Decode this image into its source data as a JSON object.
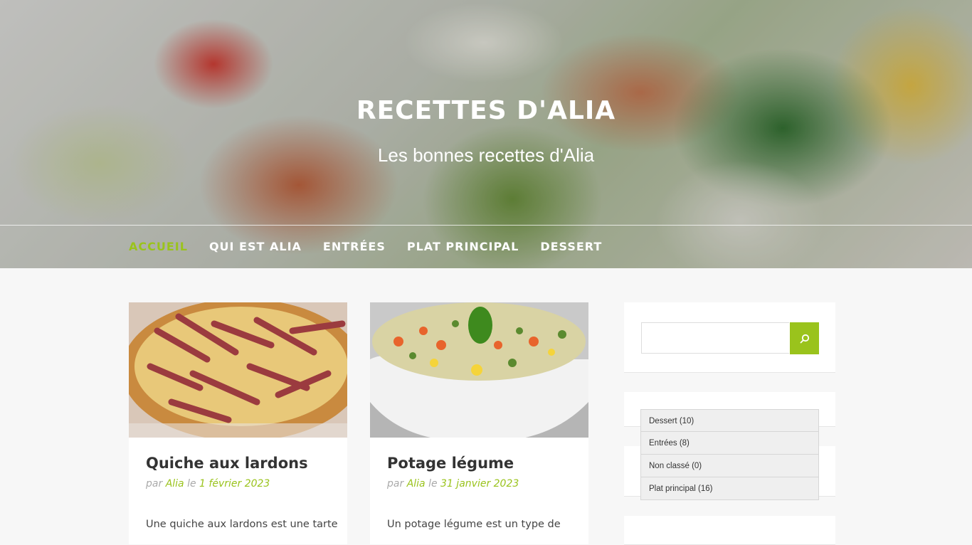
{
  "site": {
    "title": "RECETTES D'ALIA",
    "tagline": "Les bonnes recettes d'Alia"
  },
  "nav": {
    "items": [
      {
        "label": "ACCUEIL",
        "active": true
      },
      {
        "label": "QUI EST ALIA",
        "active": false
      },
      {
        "label": "ENTRÉES",
        "active": false
      },
      {
        "label": "PLAT PRINCIPAL",
        "active": false
      },
      {
        "label": "DESSERT",
        "active": false
      }
    ]
  },
  "posts": [
    {
      "title": "Quiche aux lardons",
      "meta_by": "par",
      "author": "Alia",
      "meta_on": "le",
      "date": "1 février 2023",
      "excerpt": "Une quiche aux lardons est une tarte"
    },
    {
      "title": "Potage légume",
      "meta_by": "par",
      "author": "Alia",
      "meta_on": "le",
      "date": "31 janvier 2023",
      "excerpt": "Un potage légume est un type de"
    }
  ],
  "sidebar": {
    "search": {
      "placeholder": "",
      "icon": "search-icon"
    },
    "categories": [
      "Dessert (10)",
      "Entrées (8)",
      "Non classé (0)",
      "Plat principal (16)"
    ]
  },
  "colors": {
    "accent": "#9ac31c",
    "background": "#f7f7f7"
  }
}
